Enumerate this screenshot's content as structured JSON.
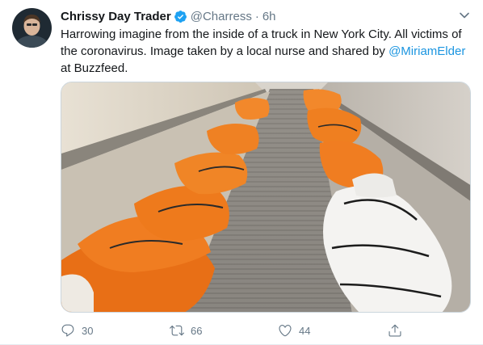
{
  "tweet": {
    "author_name": "Chrissy Day Trader",
    "handle": "@Charress",
    "separator": "·",
    "time": "6h",
    "text_before": "Harrowing imagine from the inside of a truck in New York City. All victims of the coronavirus. Image taken by a local nurse and shared by ",
    "mention": "@MiriamElder",
    "text_after": " at Buzzfeed.",
    "reply_count": "30",
    "retweet_count": "66",
    "like_count": "44"
  },
  "colors": {
    "accent": "#1b95e0",
    "secondary_text": "#657786",
    "verified": "#1da1f2"
  },
  "icons": {
    "verified": "verified-badge-icon",
    "menu": "chevron-down-icon",
    "reply": "reply-icon",
    "retweet": "retweet-icon",
    "like": "heart-icon",
    "share": "share-icon"
  }
}
